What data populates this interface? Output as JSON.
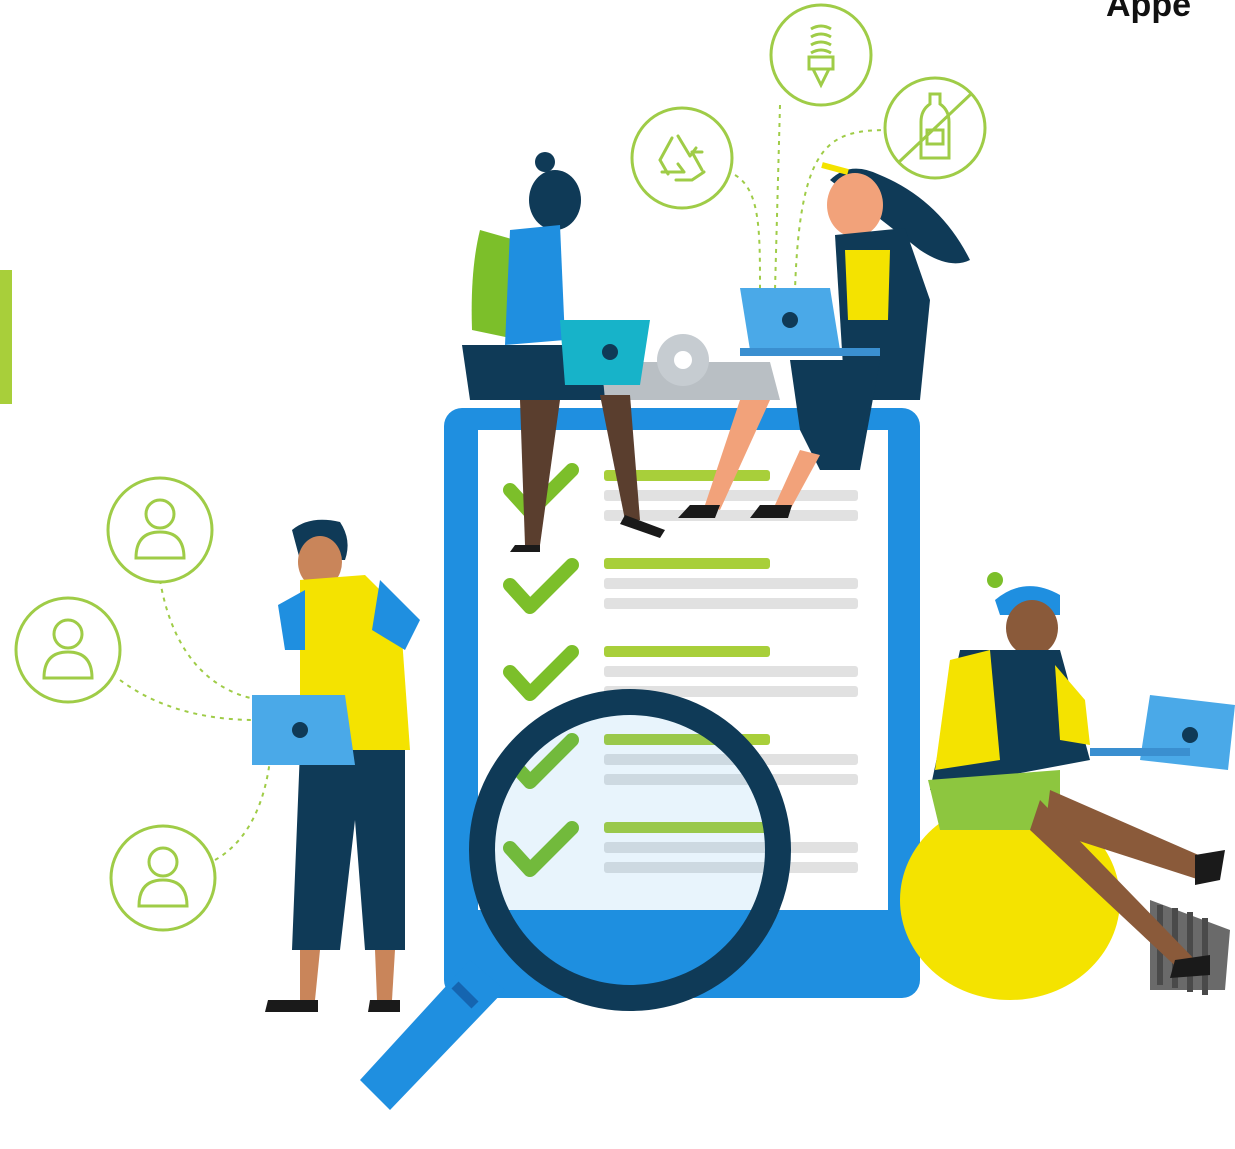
{
  "heading": {
    "text": "Appe"
  },
  "colors": {
    "accent_green": "#a8cf3a",
    "icon_green": "#9fcc47",
    "clipboard_blue": "#1f8fe0",
    "clipboard_dark_blue": "#1f6fbf",
    "navy": "#0f3a57",
    "yellow": "#f4e300",
    "skin_dark": "#5a3e2e",
    "skin_brown": "#8a5a3a",
    "laptop_blue": "#4aa9e8",
    "line_grey": "#e1e1e1"
  },
  "icons": {
    "left_column": [
      "person-icon",
      "person-icon",
      "person-icon"
    ],
    "top_row": [
      "recycle-icon",
      "lightbulb-icon",
      "no-plastic-bottle-icon"
    ]
  },
  "checklist": {
    "checked_items": 5
  }
}
